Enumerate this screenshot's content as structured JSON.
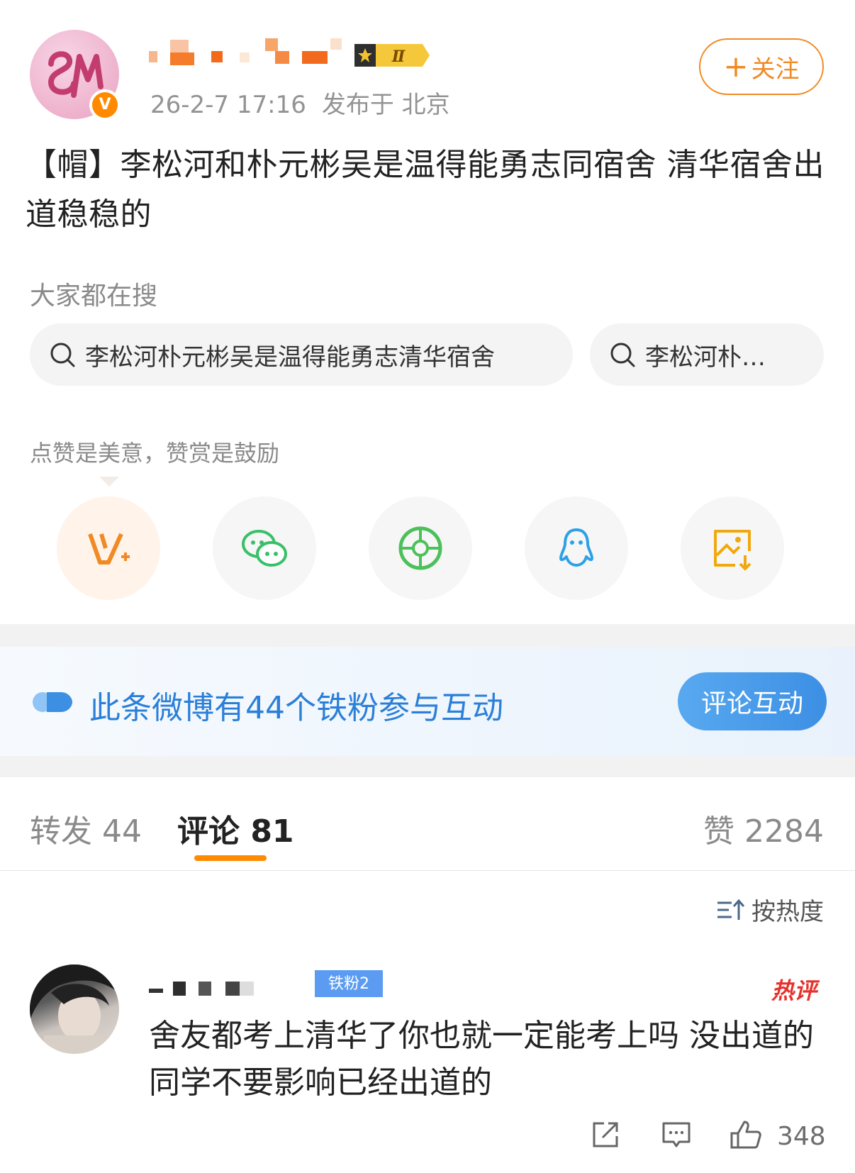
{
  "author": {
    "verified_badge": "V",
    "level_badge": "Ⅱ",
    "timestamp": "26-2-7 17:16",
    "location": "发布于 北京"
  },
  "follow_button": {
    "plus": "+",
    "label": "关注"
  },
  "post": {
    "text": "【帽】李松河和朴元彬吴是温得能勇志同宿舍 清华宿舍出道稳稳的"
  },
  "search": {
    "label": "大家都在搜",
    "chips": [
      "李松河朴元彬吴是温得能勇志清华宿舍",
      "李松河朴…"
    ]
  },
  "reward": {
    "label": "点赞是美意，赞赏是鼓励",
    "icons": [
      "v-reward-icon",
      "wechat-icon",
      "moments-icon",
      "qq-icon",
      "save-image-icon"
    ]
  },
  "fans_banner": {
    "text": "此条微博有44个铁粉参与互动",
    "button": "评论互动"
  },
  "tabs": {
    "repost": "转发 44",
    "comment": "评论 81",
    "like": "赞 2284"
  },
  "sort": {
    "label": "按热度"
  },
  "comment": {
    "badge": "铁粉2",
    "hot_tag": "热评",
    "text": "舍友都考上清华了你也就一定能考上吗 没出道的同学不要影响已经出道的",
    "like_count": "348"
  },
  "colors": {
    "accent_orange": "#f08a24",
    "link_blue": "#2b7fd8",
    "hot_red": "#e5322d"
  }
}
